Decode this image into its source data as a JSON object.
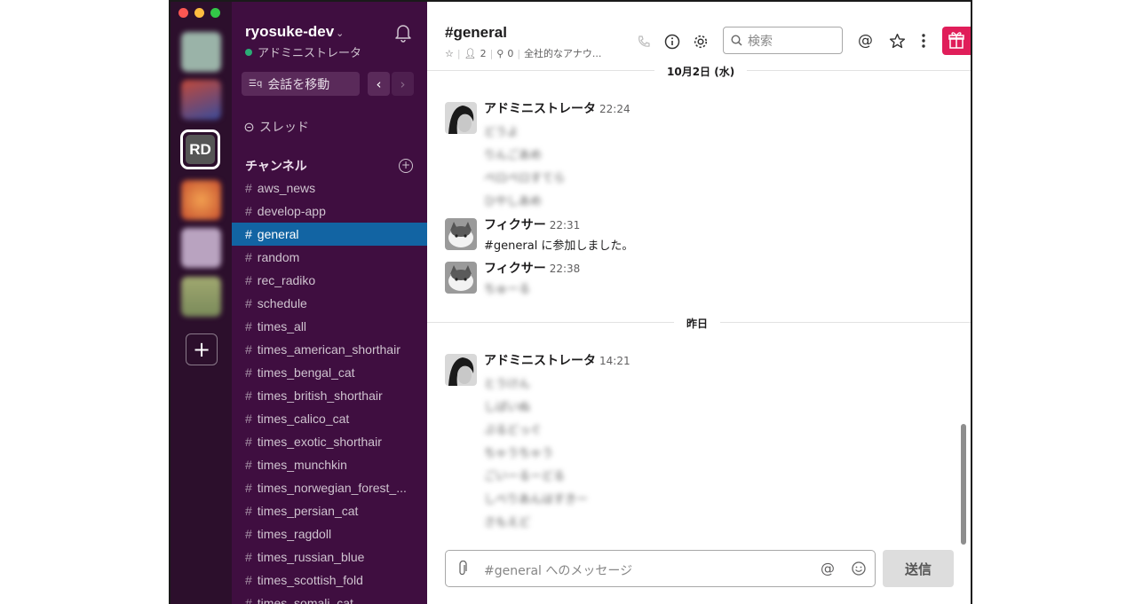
{
  "workspace": {
    "initials": "RD",
    "add_label": "+"
  },
  "sidebar": {
    "team_name": "ryosuke-dev",
    "team_chevron": "⌄",
    "status": "アドミニストレータ",
    "jump_label": "会話を移動",
    "back_label": "‹",
    "forward_label": "›",
    "threads_label": "スレッド",
    "channels_header": "チャンネル",
    "add_channel": "+",
    "channels": [
      "aws_news",
      "develop-app",
      "general",
      "random",
      "rec_radiko",
      "schedule",
      "times_all",
      "times_american_shorthair",
      "times_bengal_cat",
      "times_british_shorthair",
      "times_calico_cat",
      "times_exotic_shorthair",
      "times_munchkin",
      "times_norwegian_forest_...",
      "times_persian_cat",
      "times_ragdoll",
      "times_russian_blue",
      "times_scottish_fold",
      "times_somali_cat"
    ],
    "active_channel": "general"
  },
  "header": {
    "channel_title": "#general",
    "members": "2",
    "pins": "0",
    "topic": "全社的なアナウ...",
    "search_placeholder": "検索",
    "at_label": "@"
  },
  "messages": {
    "day1": "10月2日 (水)",
    "day2": "昨日",
    "m1": {
      "author": "アドミニストレータ",
      "time": "22:24",
      "lines": [
        "どうよ",
        "りんごあめ",
        "ペロペロすてら",
        "ひやしあめ"
      ]
    },
    "m2": {
      "author": "フィクサー",
      "time": "22:31",
      "text": "#general に参加しました。"
    },
    "m3": {
      "author": "フィクサー",
      "time": "22:38",
      "lines": [
        "ちゅーる"
      ]
    },
    "m4": {
      "author": "アドミニストレータ",
      "time": "14:21",
      "lines": [
        "とうけん",
        "しばいぬ",
        "ぷるどっぐ",
        "ちゃうちゃう",
        "ごいーるーどる",
        "しべりあんはすきー",
        "さもえど"
      ]
    }
  },
  "composer": {
    "placeholder": "#general へのメッセージ",
    "at_label": "@",
    "send_label": "送信"
  },
  "colors": {
    "rail": "#2c0f2c",
    "sidebar": "#3f0e40",
    "active": "#1264a3",
    "gift": "#e01e5a"
  }
}
